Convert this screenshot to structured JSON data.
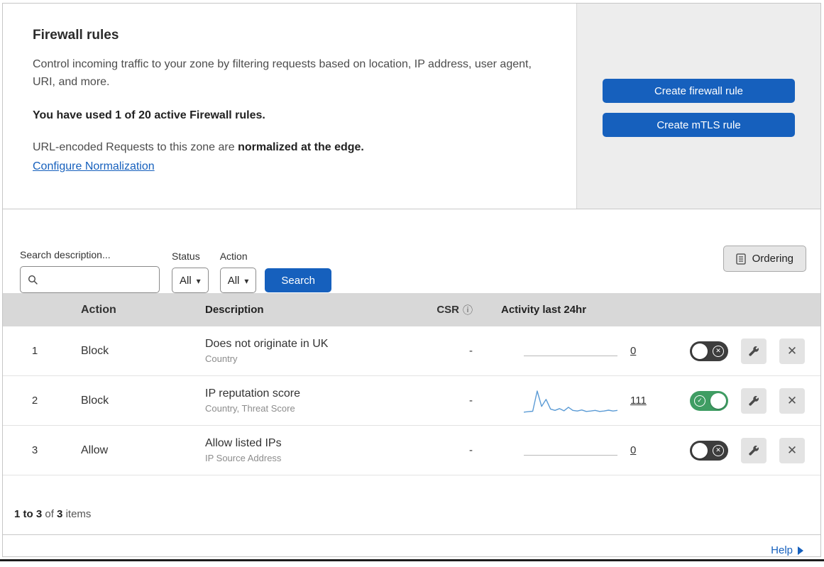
{
  "header": {
    "title": "Firewall rules",
    "description": "Control incoming traffic to your zone by filtering requests based on location, IP address, user agent, URI, and more.",
    "usage": "You have used 1 of 20 active Firewall rules.",
    "normalization_text": "URL-encoded Requests to this zone are",
    "normalization_bold": "normalized at the edge.",
    "normalization_link": "Configure Normalization",
    "buttons": {
      "create_firewall": "Create firewall rule",
      "create_mtls": "Create mTLS rule"
    }
  },
  "filters": {
    "search_label": "Search description...",
    "status": {
      "label": "Status",
      "value": "All"
    },
    "action": {
      "label": "Action",
      "value": "All"
    },
    "search_button": "Search",
    "ordering_button": "Ordering"
  },
  "table": {
    "headers": {
      "action": "Action",
      "description": "Description",
      "csr": "CSR",
      "activity": "Activity last 24hr"
    },
    "rows": [
      {
        "index": "1",
        "action": "Block",
        "description": "Does not originate in UK",
        "criteria": "Country",
        "csr": "-",
        "activity_count": "0",
        "enabled": false,
        "sparkline": []
      },
      {
        "index": "2",
        "action": "Block",
        "description": "IP reputation score",
        "criteria": "Country, Threat Score",
        "csr": "-",
        "activity_count": "111",
        "enabled": true,
        "sparkline": [
          4,
          6,
          8,
          100,
          30,
          62,
          18,
          12,
          20,
          10,
          26,
          12,
          9,
          14,
          7,
          9,
          12,
          7,
          9,
          13,
          9,
          12
        ]
      },
      {
        "index": "3",
        "action": "Allow",
        "description": "Allow listed IPs",
        "criteria": "IP Source Address",
        "csr": "-",
        "activity_count": "0",
        "enabled": false,
        "sparkline": []
      }
    ]
  },
  "footer": {
    "range": "1 to 3",
    "of_text": "of",
    "total": "3",
    "items_text": "items",
    "help": "Help"
  },
  "colors": {
    "accent_blue": "#1660bd",
    "toggle_on_green": "#3f9d63",
    "toggle_off_gray": "#3d3d3d",
    "sparkline": "#5b9bd5"
  }
}
